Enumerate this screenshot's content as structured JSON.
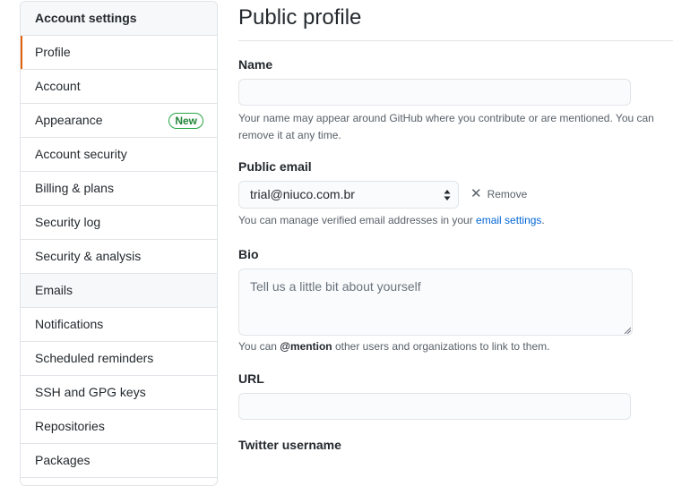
{
  "sidebar": {
    "header": "Account settings",
    "items": [
      {
        "label": "Profile"
      },
      {
        "label": "Account"
      },
      {
        "label": "Appearance",
        "badge": "New"
      },
      {
        "label": "Account security"
      },
      {
        "label": "Billing & plans"
      },
      {
        "label": "Security log"
      },
      {
        "label": "Security & analysis"
      },
      {
        "label": "Emails"
      },
      {
        "label": "Notifications"
      },
      {
        "label": "Scheduled reminders"
      },
      {
        "label": "SSH and GPG keys"
      },
      {
        "label": "Repositories"
      },
      {
        "label": "Packages"
      }
    ],
    "accent_color": "#e36209"
  },
  "main": {
    "title": "Public profile",
    "name": {
      "label": "Name",
      "value": "",
      "note": "Your name may appear around GitHub where you contribute or are mentioned. You can remove it at any time."
    },
    "public_email": {
      "label": "Public email",
      "selected": "trial@niuco.com.br",
      "remove_label": "Remove",
      "note_prefix": "You can manage verified email addresses in your ",
      "note_link": "email settings",
      "note_suffix": "."
    },
    "bio": {
      "label": "Bio",
      "placeholder": "Tell us a little bit about yourself",
      "note_prefix": "You can ",
      "note_mention": "@mention",
      "note_suffix": " other users and organizations to link to them."
    },
    "url": {
      "label": "URL",
      "value": ""
    },
    "twitter": {
      "label": "Twitter username"
    }
  }
}
